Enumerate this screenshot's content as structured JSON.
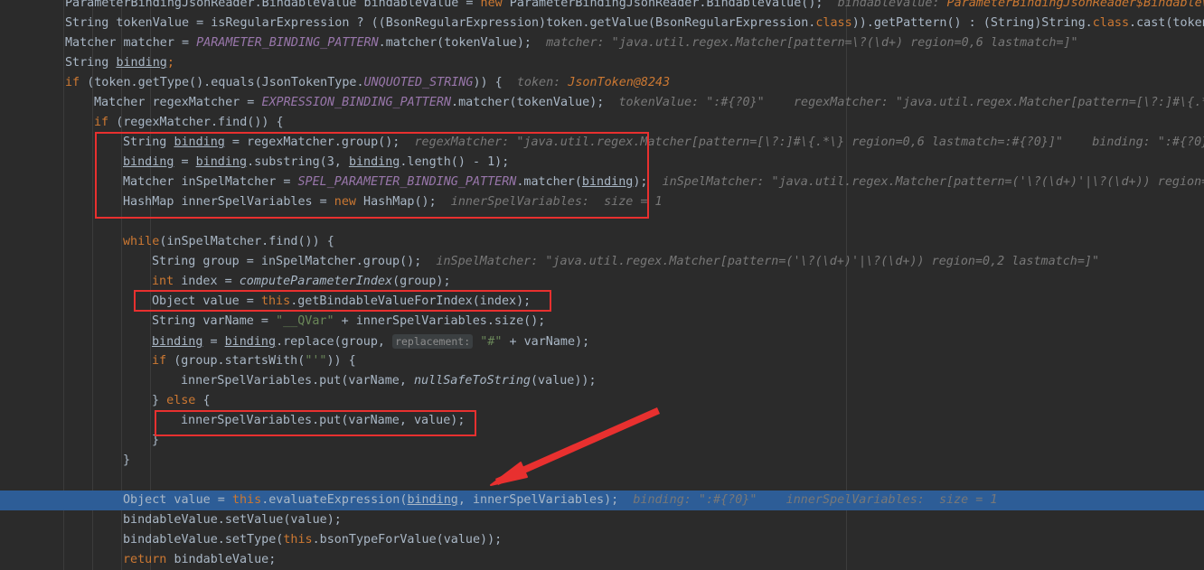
{
  "editor": {
    "lines": [
      [
        [
          "t",
          "ParameterBindingJsonReader.BindableValue bindableValue = "
        ],
        [
          "kw",
          "new "
        ],
        [
          "t",
          "ParameterBindingJsonReader.BindableValue();  "
        ],
        [
          "hint",
          "bindableValue: "
        ],
        [
          "hint-obj",
          "ParameterBindingJsonReader$BindableValue"
        ]
      ],
      [
        [
          "t",
          "String tokenValue = isRegularExpression ? ((BsonRegularExpression)token.getValue(BsonRegularExpression."
        ],
        [
          "kw",
          "class"
        ],
        [
          "t",
          ")).getPattern() : (String)String."
        ],
        [
          "kw",
          "class"
        ],
        [
          "t",
          ".cast(token."
        ]
      ],
      [
        [
          "t",
          "Matcher matcher = "
        ],
        [
          "fld",
          "PARAMETER_BINDING_PATTERN"
        ],
        [
          "t",
          ".matcher(tokenValue);  "
        ],
        [
          "hint",
          "matcher: \"java.util.regex.Matcher[pattern=\\?(\\d+) region=0,6 lastmatch=]\""
        ]
      ],
      [
        [
          "t",
          "String "
        ],
        [
          "ul",
          "binding"
        ],
        [
          "kw",
          ";"
        ]
      ],
      [
        [
          "kw",
          "if "
        ],
        [
          "t",
          "(token.getType().equals(JsonTokenType."
        ],
        [
          "fld",
          "UNQUOTED_STRING"
        ],
        [
          "t",
          ")) {  "
        ],
        [
          "hint",
          "token: "
        ],
        [
          "hint-obj",
          "JsonToken@8243"
        ]
      ],
      [
        [
          "t",
          "Matcher regexMatcher = "
        ],
        [
          "fld",
          "EXPRESSION_BINDING_PATTERN"
        ],
        [
          "t",
          ".matcher(tokenValue);  "
        ],
        [
          "hint",
          "tokenValue: \":#{?0}\"    regexMatcher: \"java.util.regex.Matcher[pattern=[\\?:]#\\{.*"
        ]
      ],
      [
        [
          "kw",
          "if "
        ],
        [
          "t",
          "(regexMatcher.find()) {"
        ]
      ],
      [
        [
          "t",
          "String "
        ],
        [
          "ul",
          "binding"
        ],
        [
          "t",
          " = regexMatcher.group();  "
        ],
        [
          "hint",
          "regexMatcher: \"java.util.regex.Matcher[pattern=[\\?:]#\\{.*\\} region=0,6 lastmatch=:#{?0}]\"    binding: \":#{?0}"
        ]
      ],
      [
        [
          "ul",
          "binding"
        ],
        [
          "t",
          " = "
        ],
        [
          "ul",
          "binding"
        ],
        [
          "t",
          ".substring(3, "
        ],
        [
          "ul",
          "binding"
        ],
        [
          "t",
          ".length() - 1);"
        ]
      ],
      [
        [
          "t",
          "Matcher inSpelMatcher = "
        ],
        [
          "fld",
          "SPEL_PARAMETER_BINDING_PATTERN"
        ],
        [
          "t",
          ".matcher("
        ],
        [
          "ul",
          "binding"
        ],
        [
          "t",
          ");  "
        ],
        [
          "hint",
          "inSpelMatcher: \"java.util.regex.Matcher[pattern=('\\?(\\d+)'|\\?(\\d+)) region="
        ]
      ],
      [
        [
          "t",
          "HashMap innerSpelVariables = "
        ],
        [
          "kw",
          "new "
        ],
        [
          "t",
          "HashMap();  "
        ],
        [
          "hint",
          "innerSpelVariables:  size = 1"
        ]
      ],
      [],
      [
        [
          "kw",
          "while"
        ],
        [
          "t",
          "(inSpelMatcher.find()) {"
        ]
      ],
      [
        [
          "t",
          "String group = inSpelMatcher.group();  "
        ],
        [
          "hint",
          "inSpelMatcher: \"java.util.regex.Matcher[pattern=('\\?(\\d+)'|\\?(\\d+)) region=0,2 lastmatch=]\""
        ]
      ],
      [
        [
          "kw",
          "int "
        ],
        [
          "t",
          "index = "
        ],
        [
          "mth",
          "computeParameterIndex"
        ],
        [
          "t",
          "(group);"
        ]
      ],
      [
        [
          "t",
          "Object value = "
        ],
        [
          "kw",
          "this"
        ],
        [
          "t",
          ".getBindableValueForIndex(index);"
        ]
      ],
      [
        [
          "t",
          "String varName = "
        ],
        [
          "str",
          "\"__QVar\""
        ],
        [
          "t",
          " + innerSpelVariables.size();"
        ]
      ],
      [
        [
          "ul",
          "binding"
        ],
        [
          "t",
          " = "
        ],
        [
          "ul",
          "binding"
        ],
        [
          "t",
          ".replace(group, "
        ],
        [
          "inlay",
          "replacement:"
        ],
        [
          "t",
          " "
        ],
        [
          "str",
          "\"#\""
        ],
        [
          "t",
          " + varName);"
        ]
      ],
      [
        [
          "kw",
          "if "
        ],
        [
          "t",
          "(group.startsWith("
        ],
        [
          "str",
          "\"'\""
        ],
        [
          "t",
          ")) {"
        ]
      ],
      [
        [
          "t",
          "innerSpelVariables.put(varName, "
        ],
        [
          "mth",
          "nullSafeToString"
        ],
        [
          "t",
          "(value));"
        ]
      ],
      [
        [
          "t",
          "} "
        ],
        [
          "kw",
          "else "
        ],
        [
          "t",
          "{"
        ]
      ],
      [
        [
          "t",
          "innerSpelVariables.put(varName, value);"
        ]
      ],
      [
        [
          "t",
          "}"
        ]
      ],
      [
        [
          "t",
          "}"
        ]
      ],
      [],
      [
        [
          "t",
          "Object value = "
        ],
        [
          "kw",
          "this"
        ],
        [
          "t",
          ".evaluateExpression("
        ],
        [
          "ul",
          "binding"
        ],
        [
          "t",
          ", innerSpelVariables);  "
        ],
        [
          "hint",
          "binding: \":#{?0}\"    innerSpelVariables:  size = 1"
        ]
      ],
      [
        [
          "t",
          "bindableValue.setValue(value);"
        ]
      ],
      [
        [
          "t",
          "bindableValue.setType("
        ],
        [
          "kw",
          "this"
        ],
        [
          "t",
          ".bsonTypeForValue(value));"
        ]
      ],
      [
        [
          "kw",
          "return "
        ],
        [
          "t",
          "bindableValue;"
        ]
      ]
    ]
  },
  "colors": {
    "background": "#2b2b2b",
    "execution_line": "#2d5d97",
    "highlight_box": "#e8302f",
    "keyword": "#cc7832"
  }
}
